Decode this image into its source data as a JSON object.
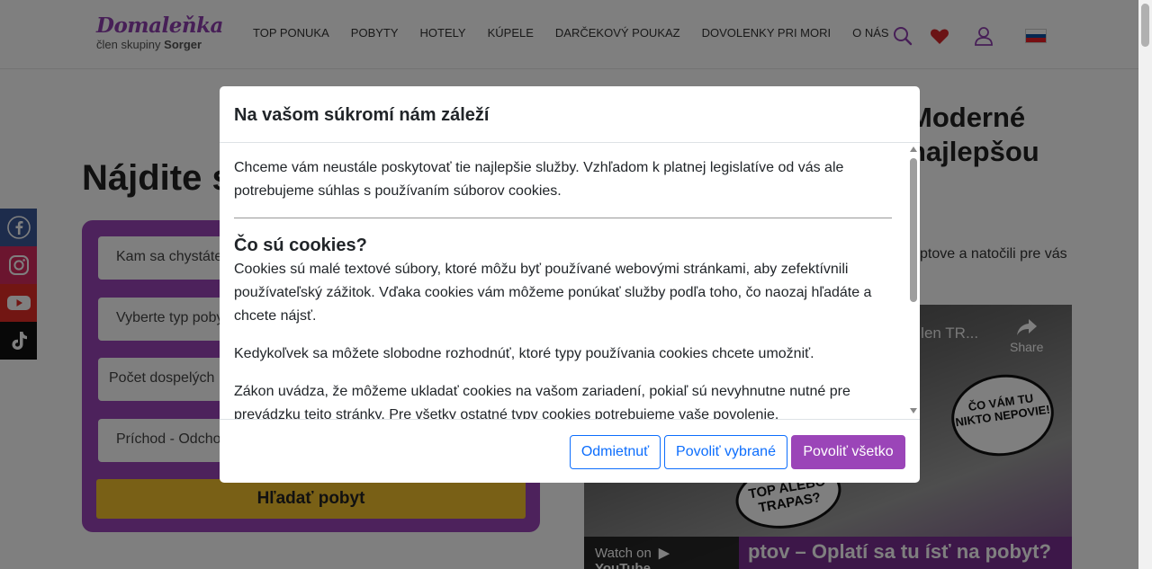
{
  "header": {
    "logo_text": "Domaleňka",
    "logo_sub_prefix": "člen skupiny ",
    "logo_sub_brand": "Sorger",
    "nav": [
      "TOP PONUKA",
      "POBYTY",
      "HOTELY",
      "KÚPELE",
      "DARČEKOVÝ POUKAZ",
      "DOVOLENKY PRI MORI",
      "O NÁS"
    ],
    "icons": [
      "search-icon",
      "heart-icon",
      "user-icon",
      "slovak-flag-icon"
    ],
    "colors": {
      "brand": "#8e3fae",
      "heart": "#d6262b"
    }
  },
  "page": {
    "hero_title": "Nájdite s",
    "right_title_line1": "Moderné",
    "right_title_line2": "najlepšou",
    "right_text": "ptove a natočili pre vás",
    "search": {
      "fields": [
        "Kam sa chystáte",
        "Vyberte typ poby",
        "Počet dospelých",
        "Príchod - Odcho"
      ],
      "button": "Hľadať pobyt"
    },
    "social": [
      "facebook-icon",
      "instagram-icon",
      "youtube-icon",
      "tiktok-icon"
    ],
    "video": {
      "title": "o len TR...",
      "share": "Share",
      "bubble1": "ČO VÁM TU NIKTO NEPOVIE!",
      "bubble2": "TOP ALEBO TRAPAS?",
      "watch_on": "Watch on",
      "youtube": "YouTube",
      "bottom": "ptov – Oplatí sa tu ísť na pobyt?"
    }
  },
  "modal": {
    "title": "Na vašom súkromí nám záleží",
    "intro": "Chceme vám neustále poskytovať tie najlepšie služby. Vzhľadom k platnej legislatíve od vás ale potrebujeme súhlas s používaním súborov cookies.",
    "heading": "Čo sú cookies?",
    "p1": "Cookies sú malé textové súbory, ktoré môžu byť používané webovými stránkami, aby zefektívnili používateľský zážitok. Vďaka cookies vám môžeme ponúkať služby podľa toho, čo naozaj hľadáte a chcete nájsť.",
    "p2": "Kedykoľvek sa môžete slobodne rozhodnúť, ktoré typy používania cookies chcete umožniť.",
    "p3": "Zákon uvádza, že môžeme ukladať cookies na vašom zariadení, pokiaľ sú nevyhnutne nutné pre prevádzku tejto stránky. Pre všetky ostatné typy cookies potrebujeme vaše povolenie.",
    "buttons": {
      "decline": "Odmietnuť",
      "allow_selected": "Povoliť vybrané",
      "allow_all": "Povoliť všetko"
    },
    "colors": {
      "primary": "#9b45b8",
      "outline": "#0d6efd"
    }
  }
}
